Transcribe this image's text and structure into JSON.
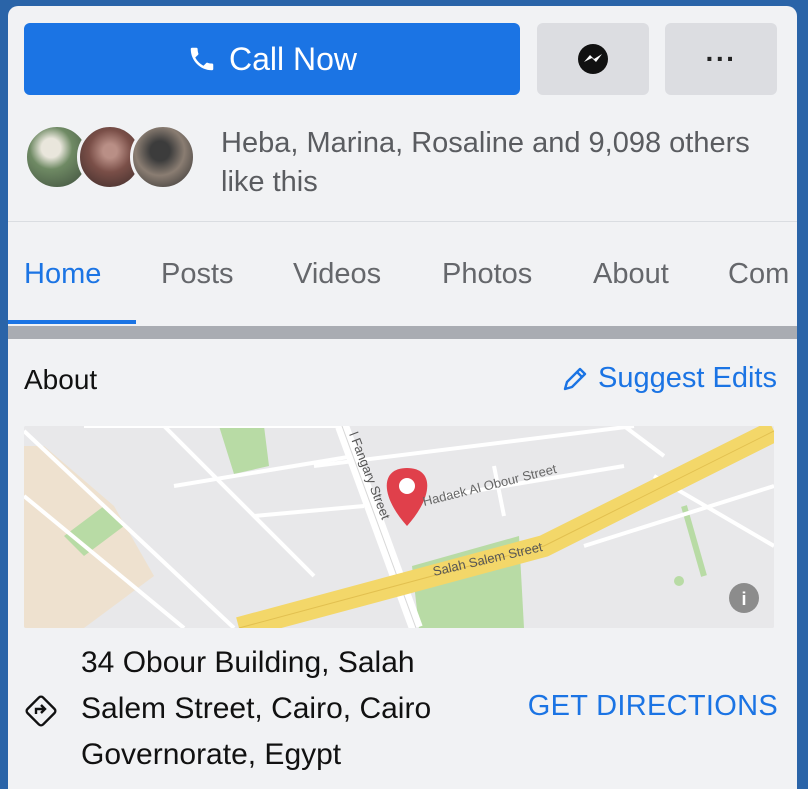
{
  "actions": {
    "call_label": "Call Now",
    "more_label": "···"
  },
  "likes": {
    "text": "Heba, Marina, Rosaline and 9,098 others like this"
  },
  "tabs": [
    "Home",
    "Posts",
    "Videos",
    "Photos",
    "About",
    "Com"
  ],
  "active_tab": "Home",
  "about": {
    "title": "About",
    "suggest_label": "Suggest Edits"
  },
  "map": {
    "streets": {
      "fangary": "l Fangary Street",
      "hadaek": "Hadaek Al Obour Street",
      "salah_salem": "Salah Salem Street"
    },
    "info_label": "i"
  },
  "address": {
    "text": "34 Obour Building, Salah Salem Street, Cairo, Cairo Governorate, Egypt",
    "directions_label": "GET DIRECTIONS"
  },
  "colors": {
    "accent": "#1b74e4",
    "pin": "#e0404b",
    "road": "#f3d769"
  }
}
